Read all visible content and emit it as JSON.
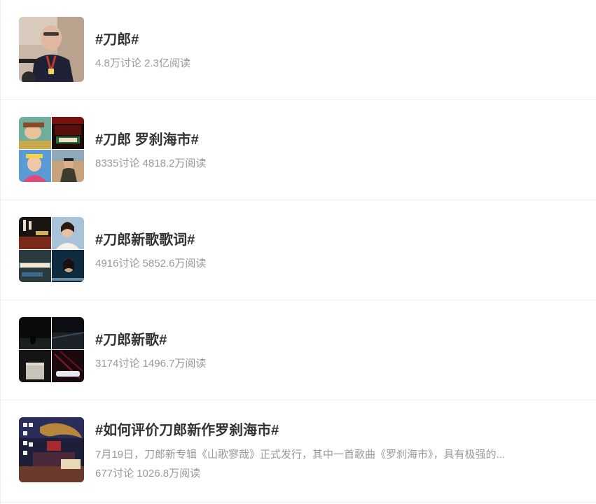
{
  "topics": [
    {
      "title": "#刀郎#",
      "stats": "4.8万讨论 2.3亿阅读"
    },
    {
      "title": "#刀郎 罗刹海市#",
      "stats": "8335讨论 4818.2万阅读"
    },
    {
      "title": "#刀郎新歌歌词#",
      "stats": "4916讨论 5852.6万阅读"
    },
    {
      "title": "#刀郎新歌#",
      "stats": "3174讨论 1496.7万阅读"
    },
    {
      "title": "#如何评价刀郎新作罗刹海市#",
      "desc": "7月19日，刀郎新专辑《山歌寥哉》正式发行，其中一首歌曲《罗刹海市》，具有极强的...",
      "stats": "677讨论 1026.8万阅读"
    }
  ]
}
